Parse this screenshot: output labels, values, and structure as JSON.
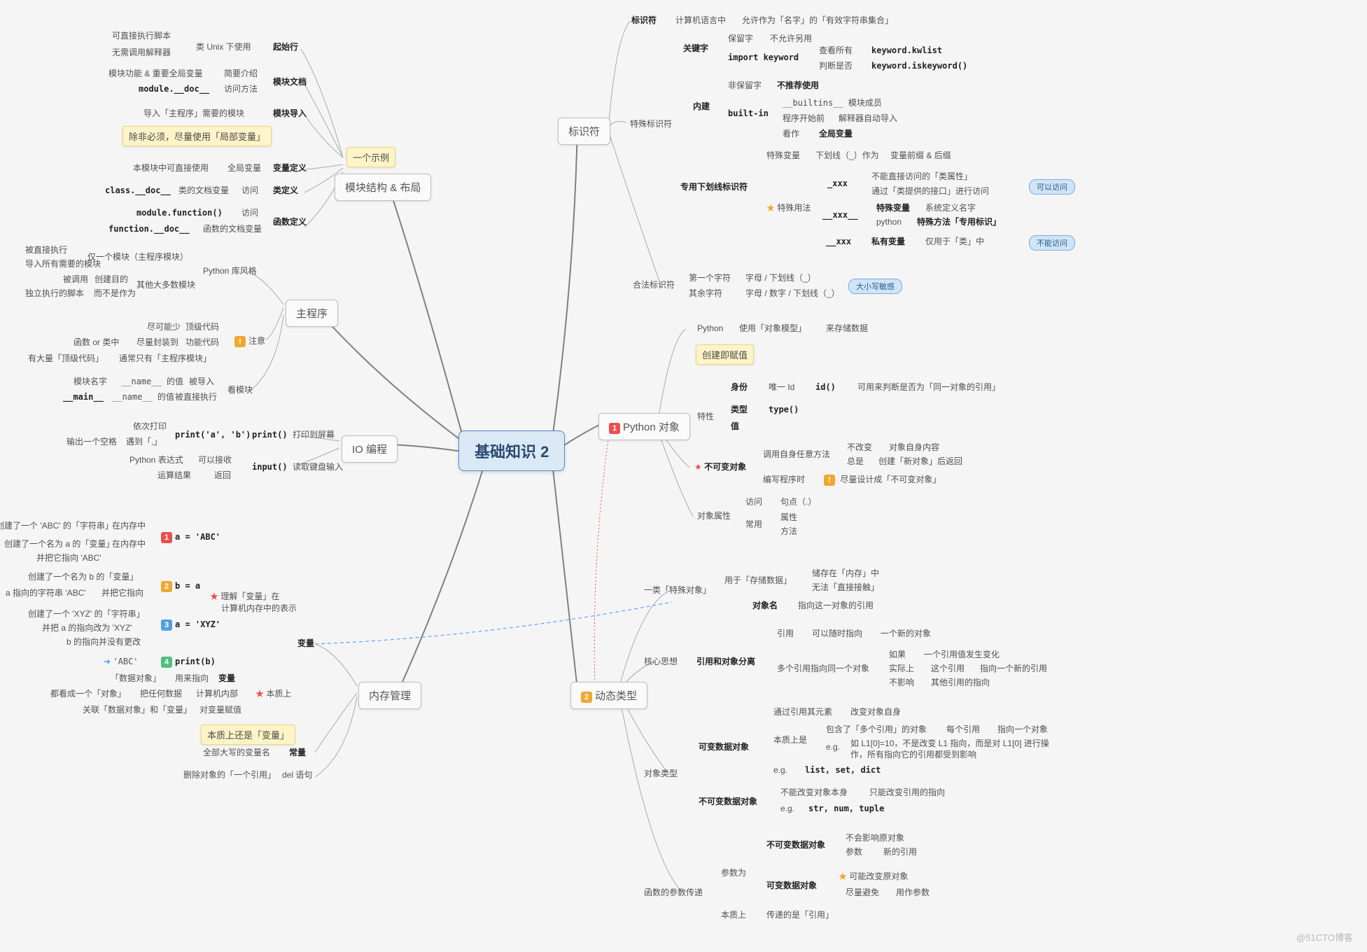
{
  "title": "基础知识 2",
  "watermark": "@51CTO博客",
  "main": {
    "m1": "模块结构 & 布局",
    "m1_sub": "一个示例",
    "m2": "主程序",
    "m3": "IO 编程",
    "m4": "内存管理",
    "m5": "标识符",
    "m6": "Python 对象",
    "m7": "动态类型"
  },
  "m1": {
    "start_label": "起始行",
    "start_a": "类 Unix 下使用",
    "start_b1": "可直接执行脚本",
    "start_b2": "无需调用解释器",
    "doc_label": "模块文档",
    "doc_a": "简要介绍",
    "doc_a_left": "模块功能 & 重要全局变量",
    "doc_b": "访问方法",
    "doc_b_left": "module.__doc__",
    "import_label": "模块导入",
    "import_a": "导入「主程序」需要的模块",
    "highlight": "除非必须，尽量使用「局部变量」",
    "vardef_label": "变量定义",
    "vardef_a": "全局变量",
    "vardef_a_left": "本模块中可直接使用",
    "classdef_label": "类定义",
    "classdef_a": "访问",
    "classdef_a_left": "类的文档变量",
    "classdef_a_left2": "class.__doc__",
    "funcdef_label": "函数定义",
    "funcdef_a": "访问",
    "funcdef_a_left": "module.function()",
    "funcdef_b": "函数的文档变量",
    "funcdef_b_left": "function.__doc__"
  },
  "m2": {
    "pystyle": "Python 库风格",
    "pystyle_a": "仅一个模块（主程序模块）",
    "pystyle_a_l1": "被直接执行",
    "pystyle_a_l2": "导入所有需要的模块",
    "pystyle_b": "其他大多数模块",
    "pystyle_b_l1": "被调用",
    "pystyle_b_l2": "创建目的",
    "pystyle_b_l3": "独立执行的脚本",
    "pystyle_b_l4": "而不是作为",
    "note": "注意",
    "note_a": "顶级代码",
    "note_a_l": "尽可能少",
    "note_b": "功能代码",
    "note_b_l": "尽量封装到",
    "note_b_l2": "函数 or 类中",
    "note_c": "通常只有「主程序模块」",
    "note_c_l": "有大量「顶级代码」",
    "seemod": "看模块",
    "seemod_a": "被导入",
    "seemod_a_l": "__name__ 的值",
    "seemod_a_l2": "模块名字",
    "seemod_b": "被直接执行",
    "seemod_b_l": "__name__ 的值",
    "seemod_b_l2": "__main__"
  },
  "m3": {
    "print": "print()",
    "print_desc": "打印到屏幕",
    "print_a": "print('a', 'b')",
    "print_a_l1": "依次打印",
    "print_a_l2": "遇到「,」",
    "print_a_l3": "输出一个空格",
    "input": "input()",
    "input_desc": "读取键盘输入",
    "input_a": "可以接收",
    "input_a_l": "Python 表达式",
    "input_b": "返回",
    "input_b_l": "运算结果"
  },
  "m4": {
    "var": "变量",
    "var_demo": "理解「变量」在",
    "var_demo2": "计算机内存中的表示",
    "step1": "a = 'ABC'",
    "step1_a": "在内存中",
    "step1_a_l": "创建了一个 'ABC' 的「字符串」",
    "step1_b": "在内存中",
    "step1_b_l": "创建了一个名为 a 的「变量」",
    "step1_c": "并把它指向 'ABC'",
    "step2": "b = a",
    "step2_a": "创建了一个名为 b 的「变量」",
    "step2_b": "并把它指向",
    "step2_b_l": "a 指向的字符串 'ABC'",
    "step3": "a = 'XYZ'",
    "step3_a": "创建了一个 'XYZ' 的「字符串」",
    "step3_b": "并把 a 的指向改为 'XYZ'",
    "step3_c": "b 的指向并没有更改",
    "step4": "print(b)",
    "step4_a": "'ABC'",
    "essence": "本质上",
    "ess_a": "变量",
    "ess_a_l": "用来指向",
    "ess_a_l2": "「数据对象」",
    "ess_b": "计算机内部",
    "ess_b_l": "把任何数据",
    "ess_b_l2": "都看成一个「对象」",
    "ess_c": "对变量赋值",
    "ess_c_l": "关联「数据对象」和「变量」",
    "essence_hl": "本质上还是「变量」",
    "const": "常量",
    "const_a": "全部大写的变量名",
    "del": "del 语句",
    "del_a": "删除对象的「一个引用」"
  },
  "m5": {
    "ident": "标识符",
    "ident_desc1": "计算机语言中",
    "ident_desc2": "允许作为「名字」的「有效字符串集合」",
    "keyword": "关键字",
    "keyword_a": "保留字",
    "keyword_a_r": "不允许另用",
    "keyword_b": "import keyword",
    "keyword_b1": "查看所有",
    "keyword_b1_r": "keyword.kwlist",
    "keyword_b2": "判断是否",
    "keyword_b2_r": "keyword.iskeyword()",
    "special": "特殊标识符",
    "builtin": "内建",
    "builtin_a": "非保留字",
    "builtin_a_r": "不推荐使用",
    "builtin_b": "built-in",
    "builtin_b1": "__builtins__ 模块成员",
    "builtin_b2": "程序开始前",
    "builtin_b2_r": "解释器自动导入",
    "builtin_b3": "看作",
    "builtin_b3_r": "全局变量",
    "underscore": "专用下划线标识符",
    "under_a": "特殊变量",
    "under_a1": "下划线（_）作为",
    "under_a2": "变量前缀 & 后缀",
    "under_b": "特殊用法",
    "under_b1": "_xxx",
    "under_b1a": "不能直接访问的「类属性」",
    "under_b1b": "通过「类提供的接口」进行访问",
    "under_b2": "__xxx__",
    "under_b2a": "特殊变量",
    "under_b2a_r": "系统定义名字",
    "under_b2b": "python",
    "under_b2b_r": "特殊方法「专用标识」",
    "under_b3": "__xxx",
    "under_b3a": "私有变量",
    "under_b3b": "仅用于「类」中",
    "legal": "合法标识符",
    "legal_a": "第一个字符",
    "legal_a_r": "字母 / 下划线（_）",
    "legal_b": "其余字符",
    "legal_b_r": "字母 / 数字 / 下划线（_）",
    "tag_case": "大小写敏感",
    "tag_can": "可以访问",
    "tag_cant": "不能访问"
  },
  "m6": {
    "python_uses": "Python",
    "uses_a": "使用「对象模型」",
    "uses_b": "来存储数据",
    "create_hl": "创建即赋值",
    "traits": "特性",
    "trait_id": "身份",
    "trait_id_a": "唯一 Id",
    "trait_id_b": "id()",
    "trait_id_c": "可用来判断是否为「同一对象的引用」",
    "trait_type": "类型",
    "trait_type_a": "type()",
    "trait_value": "值",
    "immutable": "不可变对象",
    "imm_a": "调用自身任意方法",
    "imm_a1": "不改变",
    "imm_a1_r": "对象自身内容",
    "imm_a2": "总是",
    "imm_a2_r": "创建「新对象」后返回",
    "imm_b": "编写程序时",
    "imm_b_r": "尽量设计成「不可变对象」",
    "attrs": "对象属性",
    "attrs_a": "访问",
    "attrs_a_r": "句点（.）",
    "attrs_b": "常用",
    "attrs_b1": "属性",
    "attrs_b2": "方法"
  },
  "m7": {
    "special_obj": "一类「特殊对象」",
    "so_a": "用于「存储数据」",
    "so_a1": "储存在「内存」中",
    "so_a2": "无法「直接接触」",
    "so_b": "对象名",
    "so_b_r": "指向这一对象的引用",
    "core": "核心思想",
    "core_a": "引用和对象分离",
    "core_a1": "引用",
    "core_a1a": "可以随时指向",
    "core_a1b": "一个新的对象",
    "core_a2": "多个引用指向同一个对象",
    "core_a2a": "如果",
    "core_a2a_r": "一个引用值发生变化",
    "core_a2b": "实际上",
    "core_a2b_r": "这个引用",
    "core_a2b_r2": "指向一个新的引用",
    "core_a2c": "不影响",
    "core_a2c_r": "其他引用的指向",
    "objtype": "对象类型",
    "mutable": "可变数据对象",
    "mut_a": "通过引用其元素",
    "mut_a_r": "改变对象自身",
    "mut_b": "本质上是",
    "mut_b1": "包含了「多个引用」的对象",
    "mut_b1_r": "每个引用",
    "mut_b1_r2": "指向一个对象",
    "mut_b2": "e.g.",
    "mut_b2_r": "如 L1[0]=10，不是改变 L1 指向，而是对 L1[0] 进行操作，所有指向它的引用都受到影响",
    "mut_c": "e.g.",
    "mut_c_r": "list, set, dict",
    "immutable2": "不可变数据对象",
    "imm2_a": "不能改变对象本身",
    "imm2_a_r": "只能改变引用的指向",
    "imm2_b": "e.g.",
    "imm2_b_r": "str, num, tuple",
    "funcparam": "函数的参数传递",
    "fp_a": "参数为",
    "fp_a1": "不可变数据对象",
    "fp_a1a": "不会影响原对象",
    "fp_a1b": "参数",
    "fp_a1b_r": "新的引用",
    "fp_a2": "可变数据对象",
    "fp_a2a": "可能改变原对象",
    "fp_a2b": "尽量避免",
    "fp_a2b_r": "用作参数",
    "fp_b": "本质上",
    "fp_b_r": "传递的是「引用」"
  }
}
